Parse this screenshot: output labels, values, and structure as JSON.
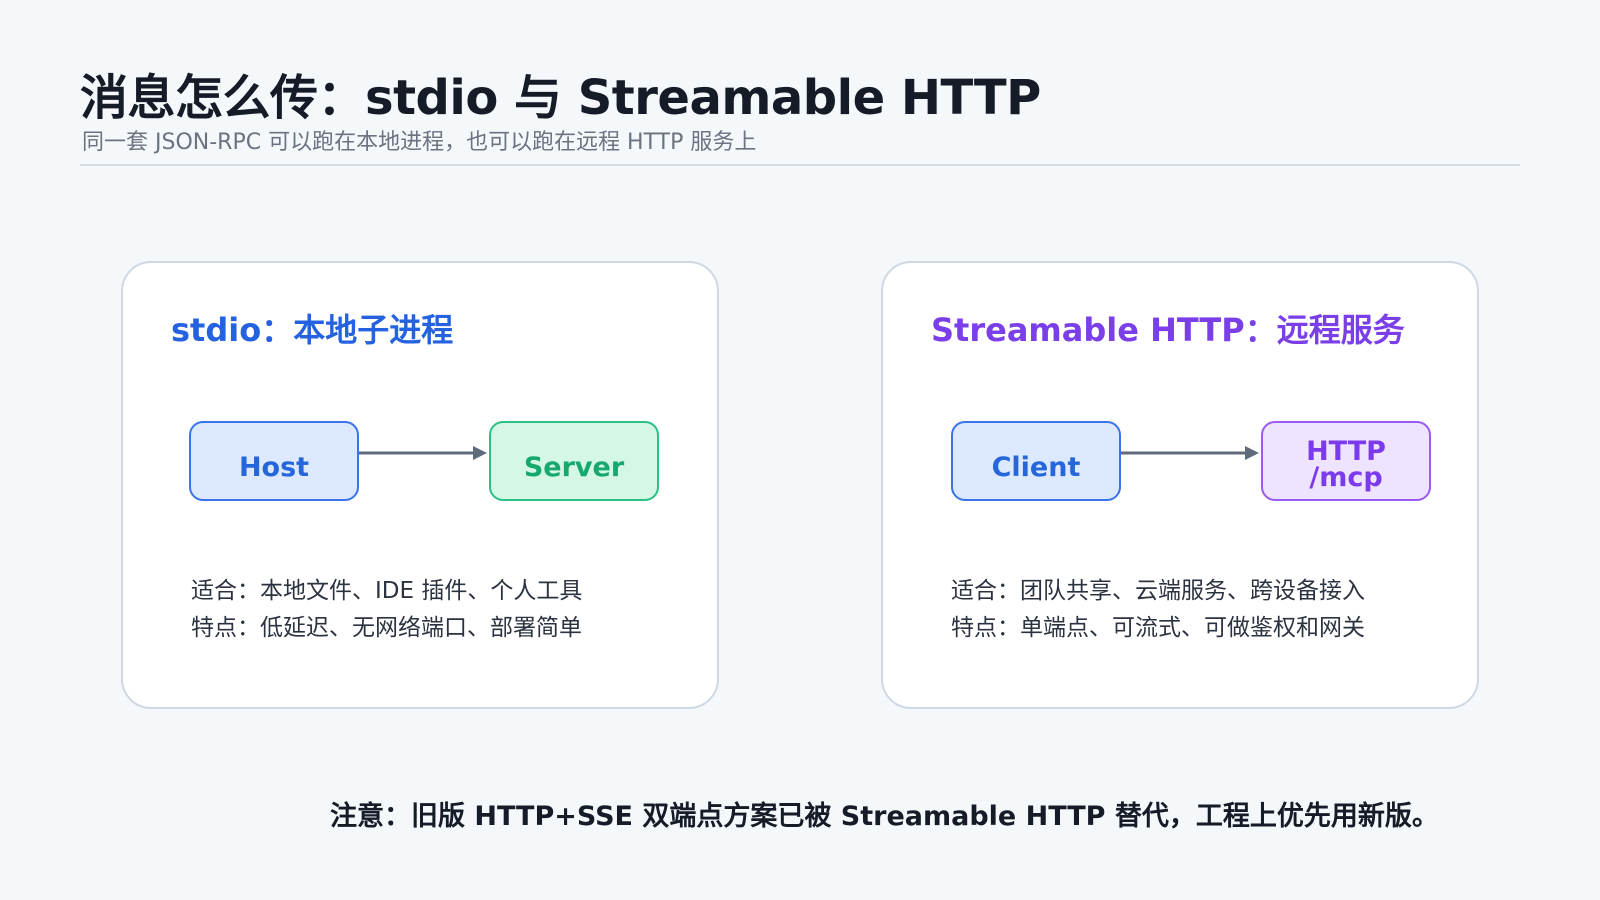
{
  "header": {
    "title": "消息怎么传：stdio 与 Streamable HTTP",
    "subtitle": "同一套 JSON-RPC 可以跑在本地进程，也可以跑在远程 HTTP 服务上"
  },
  "panels": {
    "stdio": {
      "title": "stdio：本地子进程",
      "source_node": "Host",
      "target_node": "Server",
      "line1": "适合：本地文件、IDE 插件、个人工具",
      "line2": "特点：低延迟、无网络端口、部署简单"
    },
    "http": {
      "title": "Streamable HTTP：远程服务",
      "source_node": "Client",
      "target_node_line1": "HTTP",
      "target_node_line2": "/mcp",
      "line1": "适合：团队共享、云端服务、跨设备接入",
      "line2": "特点：单端点、可流式、可做鉴权和网关"
    }
  },
  "footer": {
    "note": "注意：旧版 HTTP+SSE 双端点方案已被 Streamable HTTP 替代，工程上优先用新版。"
  },
  "colors": {
    "stdio_accent": "#2462e0",
    "http_accent": "#7b3fe9",
    "arrow": "#5f6b7a"
  }
}
